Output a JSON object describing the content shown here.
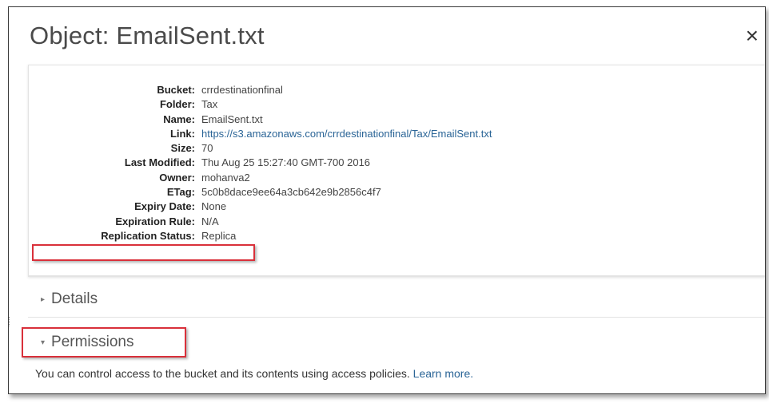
{
  "dialog": {
    "title": "Object: EmailSent.txt",
    "close_glyph": "×"
  },
  "properties": [
    {
      "label": "Bucket:",
      "value": "crrdestinationfinal"
    },
    {
      "label": "Folder:",
      "value": "Tax"
    },
    {
      "label": "Name:",
      "value": "EmailSent.txt"
    },
    {
      "label": "Link:",
      "value": "https://s3.amazonaws.com/crrdestinationfinal/Tax/EmailSent.txt"
    },
    {
      "label": "Size:",
      "value": "70"
    },
    {
      "label": "Last Modified:",
      "value": "Thu Aug 25 15:27:40 GMT-700 2016"
    },
    {
      "label": "Owner:",
      "value": "mohanva2"
    },
    {
      "label": "ETag:",
      "value": "5c0b8dace9ee64a3cb642e9b2856c4f7"
    },
    {
      "label": "Expiry Date:",
      "value": "None"
    },
    {
      "label": "Expiration Rule:",
      "value": "N/A"
    },
    {
      "label": "Replication Status:",
      "value": "Replica"
    }
  ],
  "sections": {
    "details": {
      "label": "Details",
      "icon": "caret-right-icon",
      "expanded": false
    },
    "permissions": {
      "label": "Permissions",
      "icon": "caret-down-icon",
      "expanded": true,
      "description": "You can control access to the bucket and its contents using access policies.",
      "learn_more": "Learn more."
    }
  },
  "colors": {
    "highlight": "#d9303a",
    "link": "#2a6496"
  }
}
